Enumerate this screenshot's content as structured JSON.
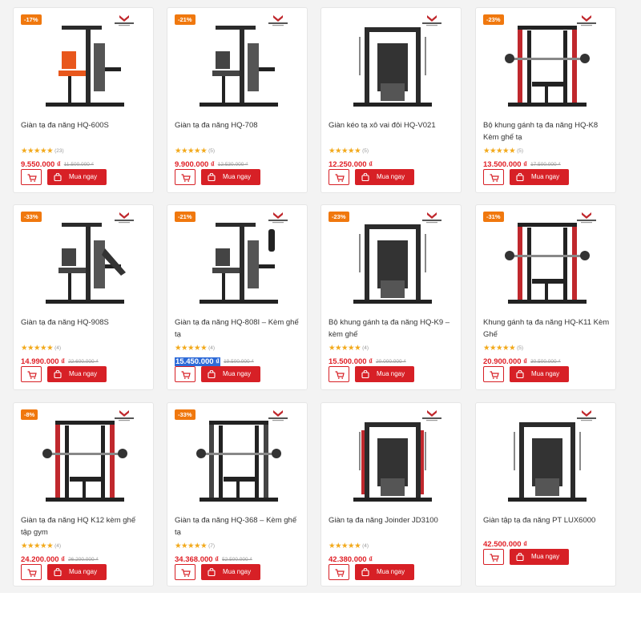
{
  "colors": {
    "accent": "#d72026",
    "price": "#e02027",
    "badge": "#f0780e",
    "star": "#f2a91b"
  },
  "products": [
    {
      "discount": "-17%",
      "title": "Giàn tạ đa năng HQ-600S",
      "stars": "★★★★★",
      "reviews": "(23)",
      "price": "9.550.000 ₫",
      "old_price": "11.500.000 ₫",
      "cart_icon": "cart-icon",
      "buy_label": "Mua ngay"
    },
    {
      "discount": "-21%",
      "title": "Giàn tạ đa năng HQ-708",
      "stars": "★★★★★",
      "reviews": "(5)",
      "price": "9.900.000 ₫",
      "old_price": "12.530.000 ₫",
      "cart_icon": "cart-icon",
      "buy_label": "Mua ngay"
    },
    {
      "discount": "",
      "title": "Giàn kéo tạ xô vai đôi HQ-V021",
      "stars": "★★★★★",
      "reviews": "(5)",
      "price": "12.250.000 ₫",
      "old_price": "",
      "cart_icon": "cart-icon",
      "buy_label": "Mua ngay"
    },
    {
      "discount": "-23%",
      "title": "Bộ khung gánh tạ đa năng HQ-K8 Kèm ghế tạ",
      "stars": "★★★★★",
      "reviews": "(5)",
      "price": "13.500.000 ₫",
      "old_price": "17.500.000 ₫",
      "cart_icon": "cart-icon",
      "buy_label": "Mua ngay"
    },
    {
      "discount": "-33%",
      "title": "Giàn tạ đa năng HQ-908S",
      "stars": "★★★★★",
      "reviews": "(4)",
      "price": "14.990.000 ₫",
      "old_price": "22.600.000 ₫",
      "cart_icon": "cart-icon",
      "buy_label": "Mua ngay"
    },
    {
      "discount": "-21%",
      "title": "Giàn tạ đa năng HQ-808I – Kèm ghế tạ",
      "stars": "★★★★★",
      "reviews": "(4)",
      "price": "15.450.000 ₫",
      "old_price": "19.500.000 ₫",
      "cart_icon": "cart-icon",
      "buy_label": "Mua ngay"
    },
    {
      "discount": "-23%",
      "title": "Bộ khung gánh tạ đa năng HQ-K9 – kèm ghế",
      "stars": "★★★★★",
      "reviews": "(4)",
      "price": "15.500.000 ₫",
      "old_price": "20.000.000 ₫",
      "cart_icon": "cart-icon",
      "buy_label": "Mua ngay"
    },
    {
      "discount": "-31%",
      "title": "Khung gánh tạ đa năng HQ-K11 Kèm Ghế",
      "stars": "★★★★★",
      "reviews": "(5)",
      "price": "20.900.000 ₫",
      "old_price": "30.500.000 ₫",
      "cart_icon": "cart-icon",
      "buy_label": "Mua ngay"
    },
    {
      "discount": "-8%",
      "title": "Giàn tạ đa năng HQ K12 kèm ghế tập gym",
      "stars": "★★★★★",
      "reviews": "(4)",
      "price": "24.200.000 ₫",
      "old_price": "26.200.000 ₫",
      "cart_icon": "cart-icon",
      "buy_label": "Mua ngay"
    },
    {
      "discount": "-33%",
      "title": "Giàn tạ đa năng HQ-368 – Kèm ghế tạ",
      "stars": "★★★★★",
      "reviews": "(7)",
      "price": "34.368.000 ₫",
      "old_price": "52.500.000 ₫",
      "cart_icon": "cart-icon",
      "buy_label": "Mua ngay"
    },
    {
      "discount": "",
      "title": "Giàn tạ đa năng Joinder JD3100",
      "stars": "★★★★★",
      "reviews": "(4)",
      "price": "42.380.000 ₫",
      "old_price": "",
      "cart_icon": "cart-icon",
      "buy_label": "Mua ngay"
    },
    {
      "discount": "",
      "title": "Giàn tập tạ đa năng PT LUX6000",
      "stars": "",
      "reviews": "",
      "price": "42.500.000 ₫",
      "old_price": "",
      "cart_icon": "cart-icon",
      "buy_label": "Mua ngay"
    }
  ]
}
